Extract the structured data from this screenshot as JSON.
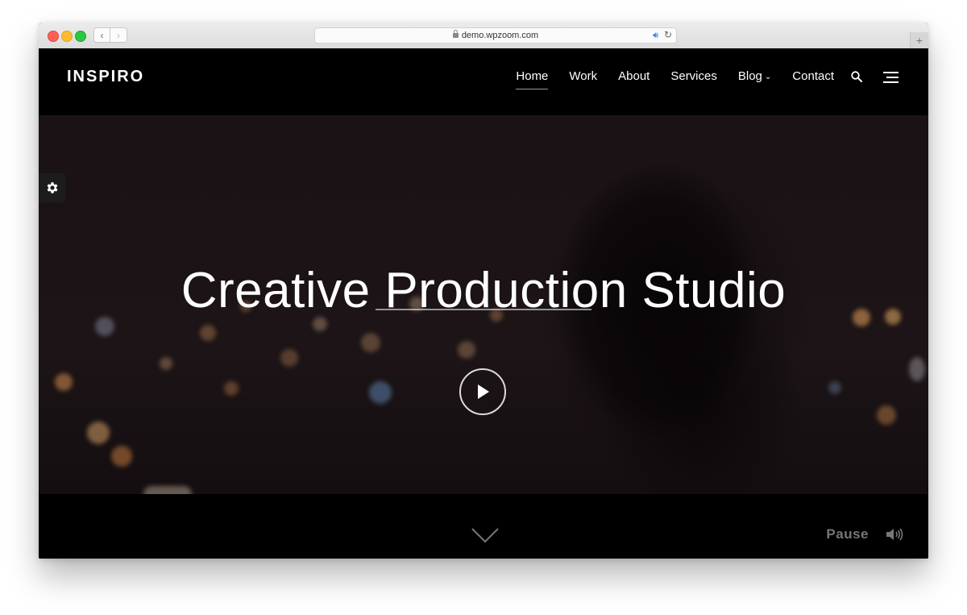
{
  "browser": {
    "url": "demo.wpzoom.com",
    "new_tab_label": "+",
    "icons": {
      "back": "chevron-left-icon",
      "forward": "chevron-right-icon",
      "lock": "lock-icon",
      "audio": "speaker-icon",
      "reload": "reload-icon"
    }
  },
  "header": {
    "logo": "INSPIRO",
    "menu": [
      {
        "label": "Home",
        "active": true
      },
      {
        "label": "Work"
      },
      {
        "label": "About"
      },
      {
        "label": "Services"
      },
      {
        "label": "Blog",
        "has_dropdown": true
      },
      {
        "label": "Contact"
      }
    ],
    "dropdown_chevron": "⌄"
  },
  "hero": {
    "title": "Creative Production Studio"
  },
  "footer_bar": {
    "pause_label": "Pause"
  },
  "colors": {
    "background": "#000000",
    "text": "#ffffff",
    "muted": "#777777"
  }
}
